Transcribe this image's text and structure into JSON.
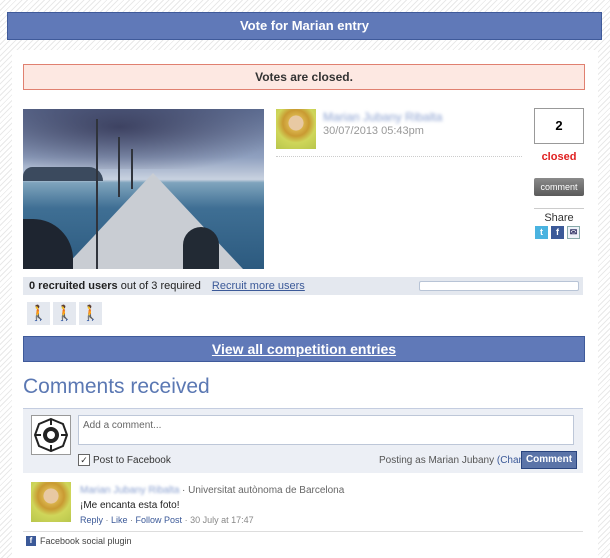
{
  "header": {
    "title": "Vote for Marian entry"
  },
  "banner": {
    "text": "Votes are closed."
  },
  "entry": {
    "author_name": "Marian Jubany Ribalta",
    "date": "30/07/2013 05:43pm"
  },
  "vote": {
    "count": "2",
    "status": "closed",
    "comment_label": "comment",
    "share_label": "Share",
    "share_icons": [
      "twitter-icon",
      "facebook-icon",
      "email-icon"
    ]
  },
  "recruit": {
    "count_text": "0 recruited users",
    "rest_text": " out of 3 required",
    "link_text": "Recruit more users",
    "progress": 0,
    "slots": 3
  },
  "nav": {
    "view_all": "View all competition entries"
  },
  "comments": {
    "title": "Comments received",
    "input_placeholder": "Add a comment...",
    "post_to_facebook": "Post to Facebook",
    "posting_as": "Posting as Marian Jubany",
    "change_label": "(Change)",
    "submit_label": "Comment",
    "items": [
      {
        "author": "Marian Jubany Ribalta",
        "affiliation": "· Universitat autònoma de Barcelona",
        "text": "¡Me encanta esta foto!",
        "reply": "Reply",
        "like": "Like",
        "follow": "Follow Post",
        "time": "· 30 July at 17:47"
      }
    ],
    "plugin_label": "Facebook social plugin"
  },
  "colors": {
    "accent": "#6079b8",
    "closed": "#e02020",
    "link": "#3b5998"
  }
}
